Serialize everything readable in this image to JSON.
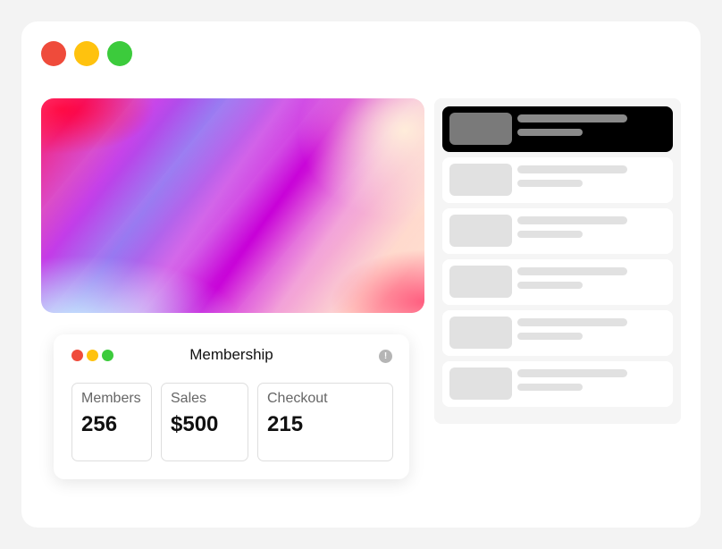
{
  "window": {
    "traffic_lights": [
      "#ef4b3b",
      "#ffc20e",
      "#3ccb3c"
    ]
  },
  "membership_card": {
    "title": "Membership",
    "info_icon": "info-icon",
    "stats": [
      {
        "label": "Members",
        "value": "256"
      },
      {
        "label": "Sales",
        "value": "$500"
      },
      {
        "label": "Checkout",
        "value": "215"
      }
    ]
  },
  "list": {
    "selected_index": 0,
    "item_count": 6
  }
}
